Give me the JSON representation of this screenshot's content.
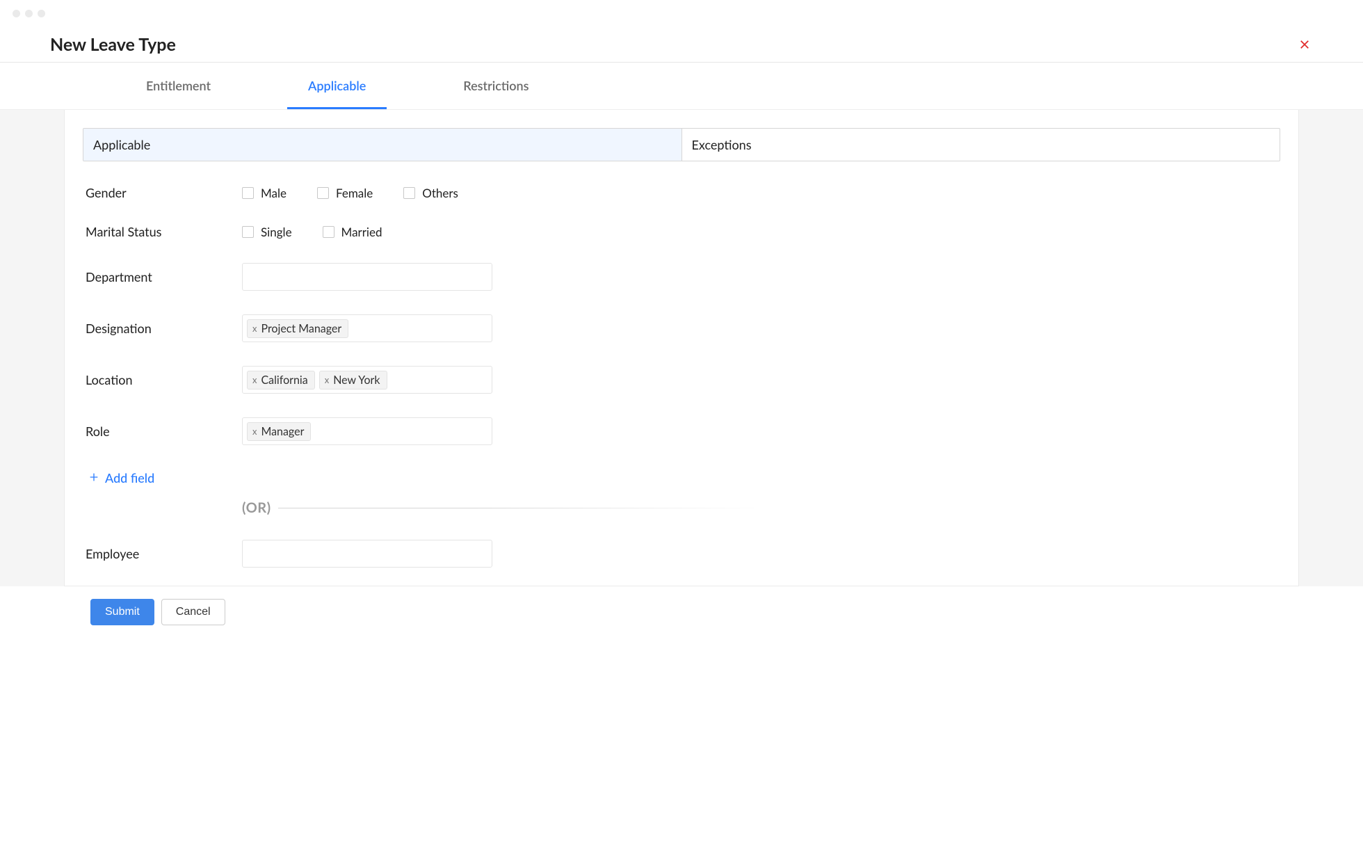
{
  "header": {
    "title": "New Leave Type"
  },
  "tabs": {
    "entitlement": "Entitlement",
    "applicable": "Applicable",
    "restrictions": "Restrictions",
    "active": "applicable"
  },
  "subtabs": {
    "applicable": "Applicable",
    "exceptions": "Exceptions",
    "active": "applicable"
  },
  "form": {
    "gender": {
      "label": "Gender",
      "options": {
        "male": "Male",
        "female": "Female",
        "others": "Others"
      }
    },
    "marital_status": {
      "label": "Marital Status",
      "options": {
        "single": "Single",
        "married": "Married"
      }
    },
    "department": {
      "label": "Department",
      "tags": []
    },
    "designation": {
      "label": "Designation",
      "tags": [
        "Project Manager"
      ]
    },
    "location": {
      "label": "Location",
      "tags": [
        "California",
        "New York"
      ]
    },
    "role": {
      "label": "Role",
      "tags": [
        "Manager"
      ]
    },
    "add_field": "Add field",
    "or_text": "(OR)",
    "employee": {
      "label": "Employee",
      "tags": []
    }
  },
  "footer": {
    "submit": "Submit",
    "cancel": "Cancel"
  }
}
